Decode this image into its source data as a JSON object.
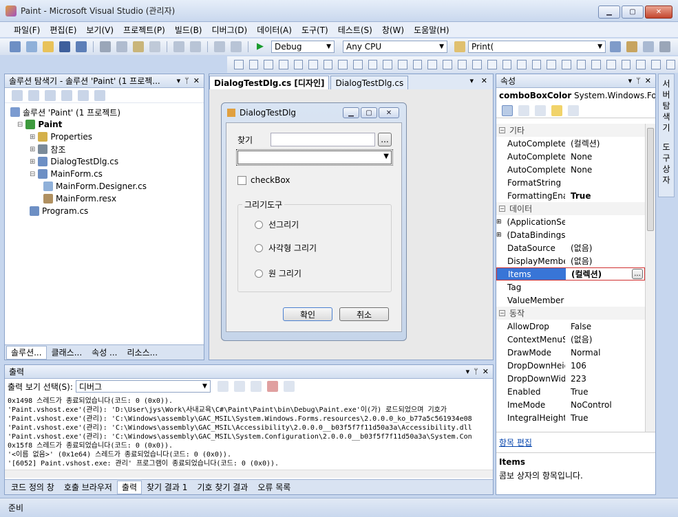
{
  "window": {
    "title": "Paint - Microsoft Visual Studio (관리자)"
  },
  "menu": [
    "파일(F)",
    "편집(E)",
    "보기(V)",
    "프로젝트(P)",
    "빌드(B)",
    "디버그(D)",
    "데이터(A)",
    "도구(T)",
    "테스트(S)",
    "창(W)",
    "도움말(H)"
  ],
  "toolbar": {
    "config": "Debug",
    "platform": "Any CPU",
    "find": "Print("
  },
  "solution": {
    "header": "솔루션 탐색기 - 솔루션 'Paint' (1 프로젝...",
    "items": [
      {
        "label": "솔루션 'Paint' (1 프로젝트)"
      },
      {
        "label": "Paint"
      },
      {
        "label": "Properties"
      },
      {
        "label": "참조"
      },
      {
        "label": "DialogTestDlg.cs"
      },
      {
        "label": "MainForm.cs"
      },
      {
        "label": "MainForm.Designer.cs"
      },
      {
        "label": "MainForm.resx"
      },
      {
        "label": "Program.cs"
      }
    ],
    "tabs": [
      "솔루션...",
      "클래스...",
      "속성 ...",
      "리소스..."
    ]
  },
  "doc": {
    "tabs": [
      "DialogTestDlg.cs [디자인]",
      "DialogTestDlg.cs"
    ],
    "dialog": {
      "title": "DialogTestDlg",
      "find_label": "찾기",
      "browse": "...",
      "checkbox": "checkBox",
      "group": "그리기도구",
      "radios": [
        "선그리기",
        "사각형 그리기",
        "원 그리기"
      ],
      "ok": "확인",
      "cancel": "취소"
    }
  },
  "output": {
    "header": "출력",
    "show_label": "출력 보기 선택(S):",
    "source": "디버그",
    "lines": [
      "0x1498 스레드가 종료되었습니다(코드: 0 (0x0)).",
      "'Paint.vshost.exe'(관리): 'D:\\User\\jys\\Work\\사내교육\\C#\\Paint\\Paint\\bin\\Debug\\Paint.exe'이(가) 로드되었으며 기호가",
      "'Paint.vshost.exe'(관리): 'C:\\Windows\\assembly\\GAC_MSIL\\System.Windows.Forms.resources\\2.0.0.0_ko_b77a5c561934e08",
      "'Paint.vshost.exe'(관리): 'C:\\Windows\\assembly\\GAC_MSIL\\Accessibility\\2.0.0.0__b03f5f7f11d50a3a\\Accessibility.dll",
      "'Paint.vshost.exe'(관리): 'C:\\Windows\\assembly\\GAC_MSIL\\System.Configuration\\2.0.0.0__b03f5f7f11d50a3a\\System.Con",
      "0x15f8 스레드가 종료되었습니다(코드: 0 (0x0)).",
      "'<이름 없음>' (0x1e64) 스레드가 종료되었습니다(코드: 0 (0x0)).",
      "'[6052] Paint.vshost.exe: 관리' 프로그램이 종료되었습니다(코드: 0 (0x0))."
    ],
    "tabs": [
      "코드 정의 창",
      "호출 브라우저",
      "출력",
      "찾기 결과 1",
      "기호 찾기 결과",
      "오류 목록"
    ]
  },
  "props": {
    "header": "속성",
    "object": "comboBoxColor",
    "type": "System.Windows.Form",
    "rows": [
      {
        "cat": "기타"
      },
      {
        "name": "AutoCompleteCu",
        "value": "(컬렉션)"
      },
      {
        "name": "AutoCompleteMc",
        "value": "None"
      },
      {
        "name": "AutoCompleteSo",
        "value": "None"
      },
      {
        "name": "FormatString",
        "value": ""
      },
      {
        "name": "FormattingEnable",
        "value": "True"
      },
      {
        "cat": "데이터"
      },
      {
        "name": "(ApplicationSettir",
        "value": ""
      },
      {
        "name": "(DataBindings)",
        "value": ""
      },
      {
        "name": "DataSource",
        "value": "(없음)"
      },
      {
        "name": "DisplayMember",
        "value": "(없음)"
      },
      {
        "name": "Items",
        "value": "(컬렉션)"
      },
      {
        "name": "Tag",
        "value": ""
      },
      {
        "name": "ValueMember",
        "value": ""
      },
      {
        "cat": "동작"
      },
      {
        "name": "AllowDrop",
        "value": "False"
      },
      {
        "name": "ContextMenuStri",
        "value": "(없음)"
      },
      {
        "name": "DrawMode",
        "value": "Normal"
      },
      {
        "name": "DropDownHeight",
        "value": "106"
      },
      {
        "name": "DropDownWidth",
        "value": "223"
      },
      {
        "name": "Enabled",
        "value": "True"
      },
      {
        "name": "ImeMode",
        "value": "NoControl"
      },
      {
        "name": "IntegralHeight",
        "value": "True"
      }
    ],
    "link": "항목 편집",
    "desc_title": "Items",
    "desc_text": "콤보 상자의 항목입니다.",
    "items_btn": "..."
  },
  "side_tabs": [
    "서버 탐색기",
    "도구 상자"
  ],
  "status": "준비"
}
